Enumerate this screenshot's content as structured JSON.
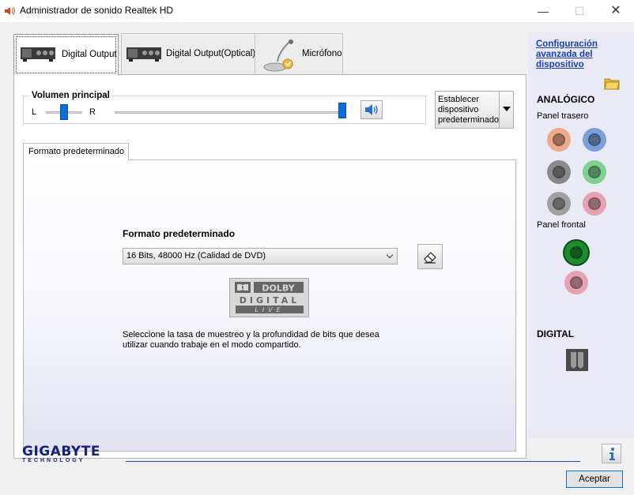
{
  "window": {
    "title": "Administrador de sonido Realtek HD",
    "controls": [
      "—",
      "☐",
      "✕"
    ]
  },
  "tabs": [
    {
      "label": "Digital Output",
      "active": true
    },
    {
      "label": "Digital Output(Optical)",
      "active": false
    },
    {
      "label": "Micrófono",
      "active": false
    }
  ],
  "volume": {
    "title": "Volumen principal",
    "left_label": "L",
    "right_label": "R",
    "balance_level": 0.5,
    "master_level": 1.0
  },
  "set_default": {
    "label": "Establecer dispositivo predeterminado"
  },
  "format": {
    "tab_label": "Formato predeterminado",
    "title": "Formato predeterminado",
    "selected": "16 Bits, 48000 Hz (Calidad de DVD)",
    "dolby_lines": [
      "DOLBY",
      "DIGITAL",
      "LIVE"
    ],
    "help": "Seleccione la tasa de muestreo y la profundidad de bits que desea utilizar cuando trabaje en el modo compartido."
  },
  "right": {
    "link": "Configuración avanzada del dispositivo",
    "analog_title": "ANALÓGICO",
    "rear_label": "Panel trasero",
    "front_label": "Panel frontal",
    "digital_title": "DIGITAL",
    "rear_jacks": [
      "#f0a98a",
      "#7b9fd8",
      "#8a8a8a",
      "#7fcf90",
      "#a0a0a0",
      "#e7a2b2"
    ],
    "front_jacks": [
      "#1e8a2e",
      "#e7a2b2"
    ]
  },
  "footer": {
    "brand": "GIGABYTE",
    "brand_sub": "TECHNOLOGY",
    "accept_label": "Aceptar"
  }
}
